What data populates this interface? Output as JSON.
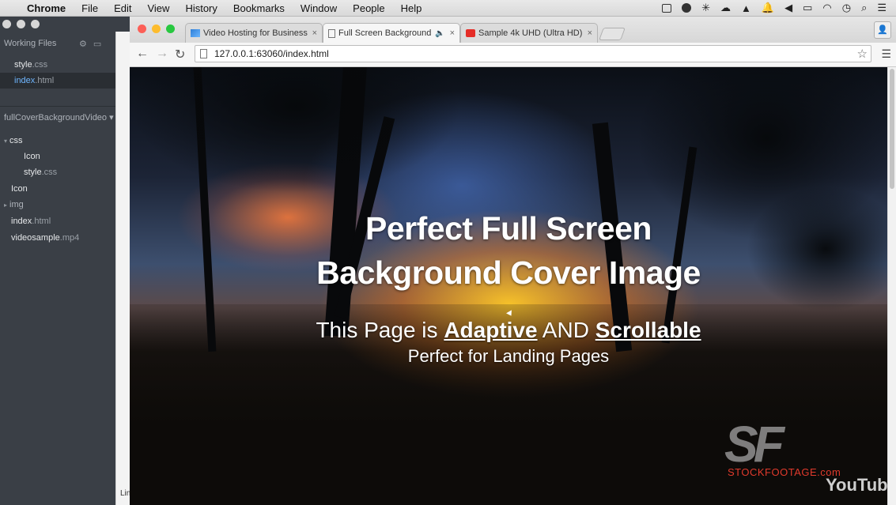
{
  "menubar": {
    "apple_icon": "apple-icon",
    "items": [
      "Chrome",
      "File",
      "Edit",
      "View",
      "History",
      "Bookmarks",
      "Window",
      "People",
      "Help"
    ]
  },
  "editor": {
    "working_files_title": "Working Files",
    "working_files": [
      {
        "name": "style",
        "ext": ".css"
      },
      {
        "name": "index",
        "ext": ".html"
      }
    ],
    "project_title": "fullCoverBackgroundVideo",
    "tree": [
      {
        "label": "css",
        "ext": "",
        "caret": "▾"
      },
      {
        "label": "Icon",
        "ext": "",
        "caret": ""
      },
      {
        "label": "style",
        "ext": ".css",
        "caret": ""
      },
      {
        "label": "Icon",
        "ext": "",
        "caret": ""
      },
      {
        "label": "img",
        "ext": "",
        "caret": "▸"
      },
      {
        "label": "index",
        "ext": ".html",
        "caret": ""
      },
      {
        "label": "videosample",
        "ext": ".mp4",
        "caret": ""
      }
    ],
    "strip_label": "Lin"
  },
  "chrome": {
    "tabs": [
      {
        "title": "Video Hosting for Business",
        "close": "×"
      },
      {
        "title": "Full Screen Background",
        "close": "×",
        "audio": "🔈"
      },
      {
        "title": "Sample 4k UHD (Ultra HD)",
        "close": "×"
      }
    ],
    "url": "127.0.0.1:63060/index.html"
  },
  "page": {
    "title_line1": "Perfect Full Screen",
    "title_line2": "Background Cover Image",
    "sub_prefix": "This Page is ",
    "sub_link1": "Adaptive",
    "sub_mid": " AND ",
    "sub_link2": "Scrollable",
    "sub2": "Perfect for Landing Pages",
    "watermark_logo": "SF",
    "watermark_text": "STOCKFOOTAGE.com",
    "youtube": "YouTube"
  },
  "colors": {
    "accent_link": "#6fb6ff",
    "youtube_red": "#e52d27",
    "sf_red": "#e03a2c"
  }
}
